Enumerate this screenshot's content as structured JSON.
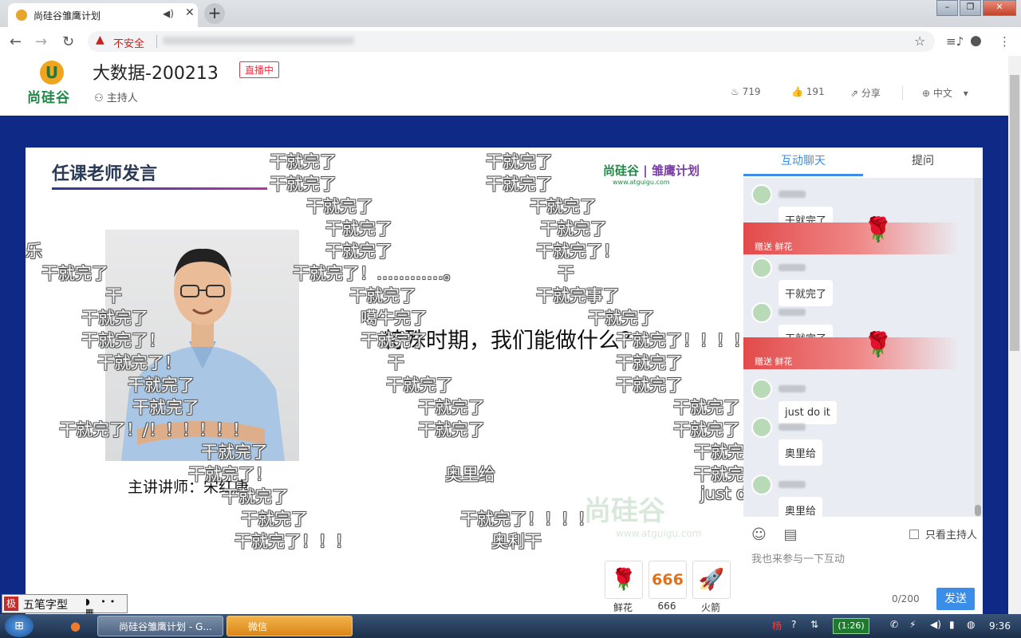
{
  "browser": {
    "tab_title": "尚硅谷雏鹰计划",
    "tab_mute_icon": "speaker-icon",
    "insecure_label": "不安全"
  },
  "header": {
    "logo_text": "尚硅谷",
    "title": "大数据-200213",
    "live_badge": "直播中",
    "host_label": "主持人",
    "views": "719",
    "likes": "191",
    "share": "分享",
    "language": "中文"
  },
  "slide": {
    "section_title": "任课老师发言",
    "logo_brand": "尚硅谷",
    "logo_sep": "|",
    "logo_program": "雏鹰计划",
    "logo_url": "www.atguigu.com",
    "question": "特殊时期，我们能做什么？",
    "caption": "主讲讲师：宋红康",
    "watermark": "尚硅谷",
    "watermark_url": "www.atguigu.com"
  },
  "danmaku": [
    "干就完了",
    "干就完了",
    "干就完了",
    "干就完了",
    "干就完了",
    "干就完了",
    "干就完了",
    "干就完了",
    "干就完了",
    "干就完了！",
    "乐",
    "干就完了",
    "干就完了！…………。",
    "干",
    "干",
    "干就完了",
    "干就完事了",
    "干就完了",
    "噶牛完了",
    "干就完了",
    "干就完了！",
    "干就完了",
    "干就完了！！！！！",
    "干就完了！",
    "干",
    "干就完了",
    "干就完了",
    "干就完了",
    "干就完了",
    "干就完了",
    "干就完了",
    "干就完了",
    "干就完了！/！！！！！！",
    "干就完了",
    "干就完了",
    "干就完了",
    "干就完了！",
    "奥里给",
    "干就完了",
    "干就完了",
    "干就完了",
    "just d",
    "干就完了",
    "干就完了！！！！",
    "干就完了！！！",
    "奥利干"
  ],
  "gifts": [
    {
      "icon": "🌹",
      "label": "鲜花"
    },
    {
      "icon": "666",
      "label": "666"
    },
    {
      "icon": "🚀",
      "label": "火箭"
    }
  ],
  "chat": {
    "tabs": [
      "互动聊天",
      "提问"
    ],
    "messages": [
      {
        "type": "msg",
        "text": "干就完了"
      },
      {
        "type": "gift",
        "text": "赠送 鲜花",
        "icon": "🌹"
      },
      {
        "type": "msg",
        "text": "干就完了"
      },
      {
        "type": "msg",
        "text": "干就完了"
      },
      {
        "type": "gift",
        "text": "赠送 鲜花",
        "icon": "🌹"
      },
      {
        "type": "msg",
        "text": "just do it"
      },
      {
        "type": "msg",
        "text": "奥里给"
      },
      {
        "type": "msg",
        "text": "奥里给"
      }
    ],
    "only_host": "只看主持人",
    "input_placeholder": "我也来参与一下互动",
    "counter": "0/200",
    "send": "发送"
  },
  "ime": {
    "badge": "极",
    "name": "五笔字型",
    "status": "◗ •• ▦"
  },
  "taskbar": {
    "chrome_item": "尚硅谷雏鹰计划 - G...",
    "wechat_item": "微信",
    "battery": "(1:26)",
    "clock": "9:36"
  }
}
